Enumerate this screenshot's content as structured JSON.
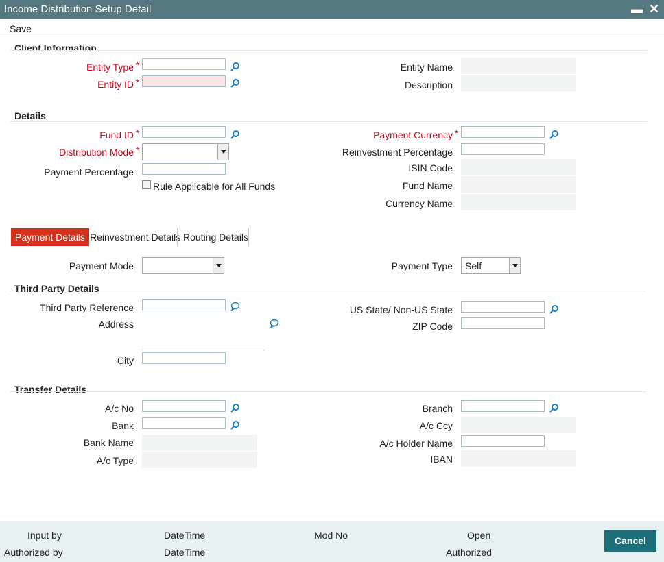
{
  "window": {
    "title": "Income Distribution Setup Detail",
    "minimize": "▬",
    "close": "✕"
  },
  "menu": {
    "save": "Save"
  },
  "client_info": {
    "heading": "Client Information",
    "entity_type": "Entity Type",
    "entity_id": "Entity ID",
    "entity_name": "Entity Name",
    "description": "Description"
  },
  "details": {
    "heading": "Details",
    "fund_id": "Fund ID",
    "distribution_mode": "Distribution Mode",
    "payment_percentage": "Payment Percentage",
    "rule_applicable": "Rule Applicable for All Funds",
    "payment_currency": "Payment Currency",
    "reinvestment_percentage": "Reinvestment Percentage",
    "isin_code": "ISIN Code",
    "fund_name": "Fund Name",
    "currency_name": "Currency Name"
  },
  "required_mark": "*",
  "tabs": {
    "payment": "Payment Details",
    "reinvestment": "Reinvestment Details",
    "routing": "Routing Details"
  },
  "payment": {
    "payment_mode": "Payment Mode",
    "payment_type": "Payment Type",
    "payment_type_value": "Self"
  },
  "third_party": {
    "heading": "Third Party Details",
    "reference": "Third Party Reference",
    "address": "Address",
    "city": "City",
    "us_state": "US State/ Non-US State",
    "zip": "ZIP Code"
  },
  "transfer": {
    "heading": "Transfer Details",
    "ac_no": "A/c No",
    "bank": "Bank",
    "bank_name": "Bank Name",
    "ac_type": "A/c Type",
    "branch": "Branch",
    "ac_ccy": "A/c Ccy",
    "ac_holder": "A/c Holder Name",
    "iban": "IBAN"
  },
  "footer": {
    "input_by": "Input by",
    "authorized_by": "Authorized by",
    "datetime1": "DateTime",
    "datetime2": "DateTime",
    "mod_no": "Mod No",
    "open": "Open",
    "authorized": "Authorized",
    "cancel": "Cancel"
  },
  "colors": {
    "title_bar": "#567880",
    "required": "#d0021b",
    "active_tab": "#d4301a",
    "footer_bg": "#e7f1f2",
    "cancel_bg": "#1d6e7b",
    "lookup_icon": "#1a7fc1"
  },
  "icons": {
    "lookup": "magnifier-icon",
    "address": "speech-bubble-icon"
  }
}
